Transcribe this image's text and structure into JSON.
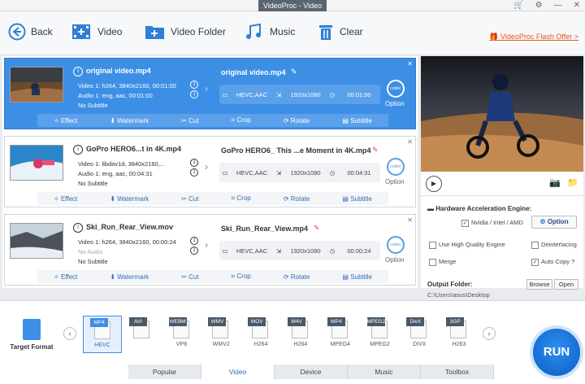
{
  "app": {
    "title": "VideoProc - Video"
  },
  "toolbar": {
    "back": "Back",
    "video": "Video",
    "video_folder": "Video Folder",
    "music": "Music",
    "clear": "Clear",
    "flash": "VideoProc Flash Offer >"
  },
  "items": [
    {
      "input_name": "original video.mp4",
      "video": "Video 1: h264, 3840x2160, 00:01:00",
      "audio": "Audio 1: eng, aac, 00:01:00",
      "subtitle": "No Subtitle",
      "v_idx": "1",
      "a_idx": "1",
      "output_name": "original video.mp4",
      "codec": "HEVC,AAC",
      "res": "1920x1080",
      "dur": "00:01:00",
      "option": "Option"
    },
    {
      "input_name": "GoPro HERO6...t in 4K.mp4",
      "video": "Video 1: libdav1d, 3840x2160,...",
      "audio": "Audio 1: eng, aac, 00:04:31",
      "subtitle": "No Subtitle",
      "v_idx": "1",
      "a_idx": "1",
      "output_name": "GoPro HERO6_ This ...e Moment in 4K.mp4",
      "codec": "HEVC,AAC",
      "res": "1920x1080",
      "dur": "00:04:31",
      "option": "Option"
    },
    {
      "input_name": "Ski_Run_Rear_View.mov",
      "video": "Video 1: h264, 3840x2160, 00:00:24",
      "audio": "No Audio",
      "subtitle": "No Subtitle",
      "v_idx": "1",
      "a_idx": "1",
      "output_name": "Ski_Run_Rear_View.mp4",
      "codec": "HEVC,AAC",
      "res": "1920x1080",
      "dur": "00:00:24",
      "option": "Option"
    }
  ],
  "actions": [
    "Effect",
    "Watermark",
    "Cut",
    "Crop",
    "Rotate",
    "Subtitle"
  ],
  "codec_icon": "codec",
  "panel": {
    "hw_title": "Hardware Acceleration Engine:",
    "nvidia": "Nvidia / Intel / AMD",
    "option": "Option",
    "hq": "Use High Quality Engine",
    "deinterlace": "Deinterlacing",
    "merge": "Merge",
    "autocopy": "Auto Copy",
    "help": "?",
    "output_folder": "Output Folder:",
    "browse": "Browse",
    "open": "Open",
    "path": "C:\\Users\\asus\\Desktop"
  },
  "target": {
    "label": "Target Format"
  },
  "formats": [
    {
      "tag": "MP4",
      "sub": "HEVC"
    },
    {
      "tag": "AVI",
      "sub": ""
    },
    {
      "tag": "WEBM",
      "sub": "VP8"
    },
    {
      "tag": "WMV",
      "sub": "WMV2"
    },
    {
      "tag": "MOV",
      "sub": "H264"
    },
    {
      "tag": "M4V",
      "sub": "H264"
    },
    {
      "tag": "MP4",
      "sub": "MPEG4"
    },
    {
      "tag": "MPEG2",
      "sub": "MPEG2"
    },
    {
      "tag": "DivX",
      "sub": "DIVX"
    },
    {
      "tag": "3GP",
      "sub": "H263"
    }
  ],
  "tabs": [
    "Popular",
    "Video",
    "Device",
    "Music",
    "Toolbox"
  ],
  "run": "RUN"
}
